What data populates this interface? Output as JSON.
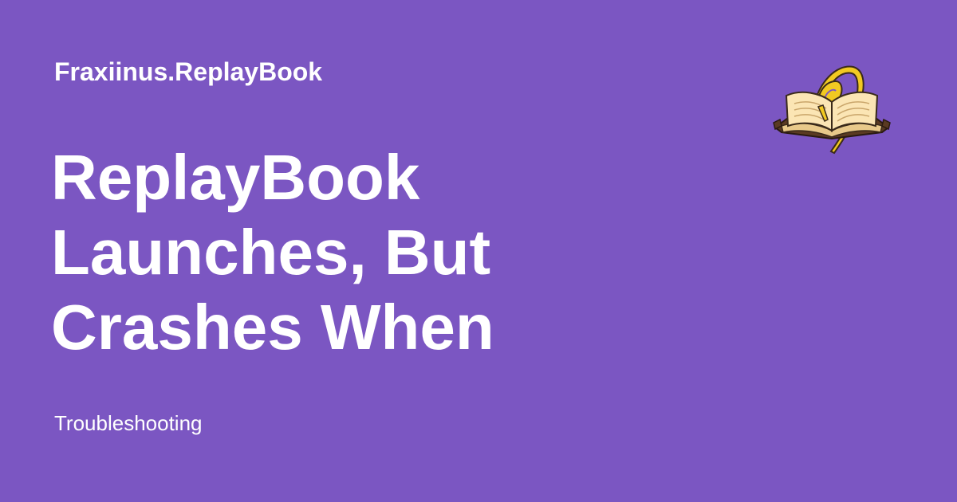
{
  "site": {
    "name": "Fraxiinus.ReplayBook"
  },
  "article": {
    "title_lines": [
      "ReplayBook",
      "Launches, But",
      "Crashes When"
    ],
    "category": "Troubleshooting"
  },
  "logo": {
    "icon": "open-book-quill-icon"
  },
  "colors": {
    "background": "#7b56c2",
    "text": "#ffffff",
    "quill": "#f2c922",
    "page": "#fbe5b4",
    "cover": "#5a3a22"
  }
}
